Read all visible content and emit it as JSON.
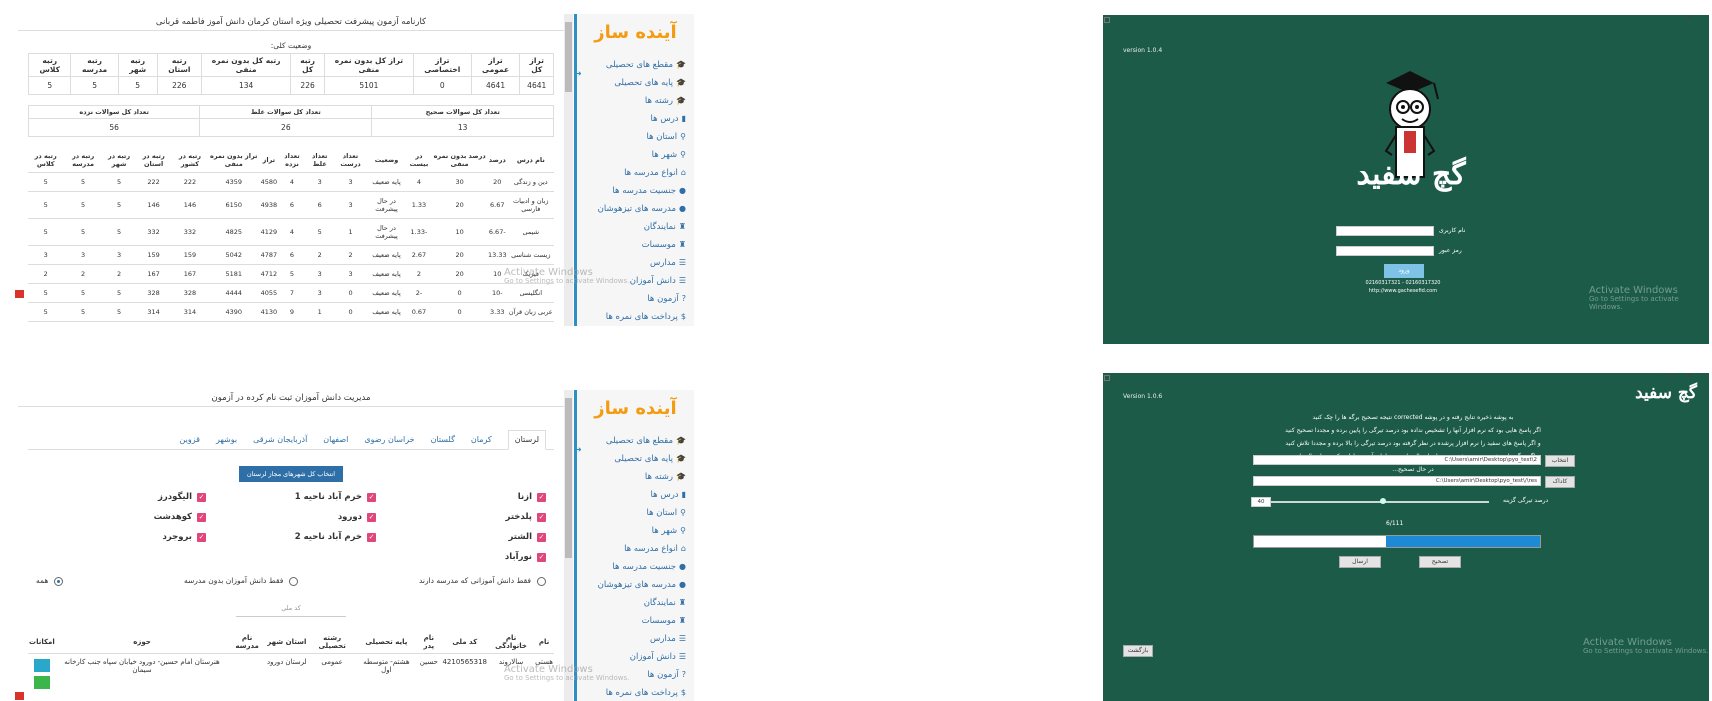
{
  "sidebar": {
    "brand": "آینده ساز",
    "items": [
      {
        "label": "مقطع های تحصیلی",
        "icon": "graduation-cap-icon",
        "glyph": "🎓"
      },
      {
        "label": "پایه های تحصیلی",
        "icon": "graduation-cap-icon",
        "glyph": "🎓"
      },
      {
        "label": "رشته ها",
        "icon": "graduation-cap-icon",
        "glyph": "🎓"
      },
      {
        "label": "درس ها",
        "icon": "book-icon",
        "glyph": "▮"
      },
      {
        "label": "استان ها",
        "icon": "map-marker-icon",
        "glyph": "⚲"
      },
      {
        "label": "شهر ها",
        "icon": "map-marker-icon",
        "glyph": "⚲"
      },
      {
        "label": "انواع مدرسه ها",
        "icon": "home-icon",
        "glyph": "⌂"
      },
      {
        "label": "جنسیت مدرسه ها",
        "icon": "user-icon",
        "glyph": "●"
      },
      {
        "label": "مدرسه های تیزهوشان",
        "icon": "user-icon",
        "glyph": "●"
      },
      {
        "label": "نمایندگان",
        "icon": "user-tie-icon",
        "glyph": "♜"
      },
      {
        "label": "موسسات",
        "icon": "institution-icon",
        "glyph": "♜"
      },
      {
        "label": "مدارس",
        "icon": "list-icon",
        "glyph": "☰"
      },
      {
        "label": "دانش آموزان",
        "icon": "list-icon",
        "glyph": "☰"
      },
      {
        "label": "آزمون ها",
        "icon": "question-icon",
        "glyph": "?"
      },
      {
        "label": "پرداخت های نمره ها",
        "icon": "money-icon",
        "glyph": "$"
      }
    ]
  },
  "windows_watermark": {
    "title": "Activate Windows",
    "subtitle": "Go to Settings to activate Windows."
  },
  "report": {
    "title": "کارنامه آزمون پیشرفت تحصیلی ویژه استان کرمان دانش آموز فاطمه قربانی",
    "overall_label": "وضعیت کلی:",
    "overall_headers": [
      "تراز کل",
      "تراز عمومی",
      "تراز اختصاصی",
      "تراز کل بدون نمره منفی",
      "رتبه کل",
      "رتبه کل بدون نمره منفی",
      "رتبه استان",
      "رتبه شهر",
      "رتبه مدرسه",
      "رتبه کلاس"
    ],
    "overall_values": [
      "4641",
      "4641",
      "0",
      "5101",
      "226",
      "134",
      "226",
      "5",
      "5",
      "5"
    ],
    "count_headers": [
      "تعداد کل سوالات صحیح",
      "تعداد کل سوالات غلط",
      "تعداد کل سوالات نزده"
    ],
    "count_values": [
      "13",
      "26",
      "56"
    ],
    "subject_headers": [
      "نام درس",
      "درصد",
      "درصد بدون نمره منفی",
      "در بیست",
      "وضعیت",
      "تعداد درست",
      "تعداد غلط",
      "تعداد نزده",
      "تراز",
      "تراز بدون نمره منفی",
      "رتبه در کشور",
      "رتبه در استان",
      "رتبه در شهر",
      "رتبه در مدرسه",
      "رتبه در کلاس"
    ],
    "subject_rows": [
      [
        "دین و زندگی",
        "20",
        "30",
        "4",
        "پایه ضعیف",
        "3",
        "3",
        "4",
        "4580",
        "4359",
        "222",
        "222",
        "5",
        "5",
        "5"
      ],
      [
        "زبان و ادبیات فارسی",
        "6.67",
        "20",
        "1.33",
        "در حال پیشرفت",
        "3",
        "6",
        "6",
        "4938",
        "6150",
        "146",
        "146",
        "5",
        "5",
        "5"
      ],
      [
        "شیمی",
        "-6.67",
        "10",
        "-1.33",
        "در حال پیشرفت",
        "1",
        "5",
        "4",
        "4129",
        "4825",
        "332",
        "332",
        "5",
        "5",
        "5"
      ],
      [
        "زیست شناسی",
        "13.33",
        "20",
        "2.67",
        "پایه ضعیف",
        "2",
        "2",
        "6",
        "4787",
        "5042",
        "159",
        "159",
        "3",
        "3",
        "3"
      ],
      [
        "فیزیک",
        "10",
        "20",
        "2",
        "پایه ضعیف",
        "3",
        "3",
        "5",
        "4712",
        "5181",
        "167",
        "167",
        "2",
        "2",
        "2"
      ],
      [
        "انگلیسی",
        "-10",
        "0",
        "-2",
        "پایه ضعیف",
        "0",
        "3",
        "7",
        "4055",
        "4444",
        "328",
        "328",
        "5",
        "5",
        "5"
      ],
      [
        "عربی زبان قرآن",
        "3.33",
        "0",
        "0.67",
        "پایه ضعیف",
        "0",
        "1",
        "9",
        "4130",
        "4390",
        "314",
        "314",
        "5",
        "5",
        "5"
      ]
    ]
  },
  "students": {
    "title": "مدیریت دانش آموزان ثبت نام کرده در آزمون",
    "tabs": [
      "لرستان",
      "کرمان",
      "گلستان",
      "خراسان رضوی",
      "اصفهان",
      "آذربایجان شرقی",
      "بوشهر",
      "قزوین"
    ],
    "select_all": "انتخاب کل شهرهای مجاز لرستان",
    "cities": [
      "ازنا",
      "خرم آباد ناحیه 1",
      "الیگودرز",
      "پلدختر",
      "دورود",
      "کوهدشت",
      "الشتر",
      "خرم آباد ناحیه 2",
      "بروجرد",
      "نورآباد"
    ],
    "radio_options": [
      "فقط دانش آموزانی که مدرسه دارند",
      "فقط دانش آموزان بدون مدرسه",
      "همه"
    ],
    "national_code_placeholder": "کد ملی",
    "table_headers": [
      "نام",
      "نام خانوادگی",
      "کد ملی",
      "نام پدر",
      "پایه تحصیلی",
      "رشته تحصیلی",
      "استان",
      "شهر",
      "نام مدرسه",
      "حوزه",
      "امکانات"
    ],
    "rows": [
      [
        "هستی",
        "سالاروند",
        "4210565318",
        "حسین",
        "هشتم- متوسطه اول",
        "عمومی",
        "لرستان",
        "دورود",
        "",
        "هنرستان امام حسین- دورود خیابان سپاه جنب کارخانه سیمان",
        ""
      ]
    ]
  },
  "login": {
    "version": "version 1.0.4",
    "brand": "گچ سفید",
    "username_label": "نام کاربری",
    "password_label": "رمز عبور",
    "login_button": "ورود",
    "phones": "02160317321 - 02160317320",
    "url": "http://www.gachesefid.com"
  },
  "correction": {
    "version": "Version 1.0.6",
    "brand": "گچ سفید",
    "instructions": [
      "به پوشه ذخیره نتایج رفته و در پوشه corrected نتیجه تصحیح برگه ها را چک کنید",
      "اگر پاسخ هایی بود که نرم افزار آنها را تشخیص نداده بود درصد تیرگی را پایین برده و مجددا تصحیح کنید",
      "و اگر پاسخ های سفید را نرم افزار پرشده در نظر گرفته بود درصد تیرگی را بالا برده و مجددا تلاش کنید",
      "و اگر برگه ها به خوبی تصحیح شده بود برای ارسال نتایج به سامانه آینده سازان دکمه ی ارسال را بزنید",
      "در حال تصحیح..."
    ],
    "choose_button": "انتخاب",
    "folder_button": "کاداک",
    "path1": "C:\\Users\\amir\\Desktop\\pyo_test\\2",
    "path2": "C:\\Users\\amir\\Desktop\\pyo_test\\/\\res",
    "darkness_label": "درصد تیرگی گزینه",
    "darkness_value": "40",
    "darkness_fraction": 0.5,
    "progress_text": "6/111",
    "progress_fraction": 0.54,
    "correct_button": "تصحیح",
    "send_button": "ارسال",
    "back_button": "بازگشت"
  }
}
